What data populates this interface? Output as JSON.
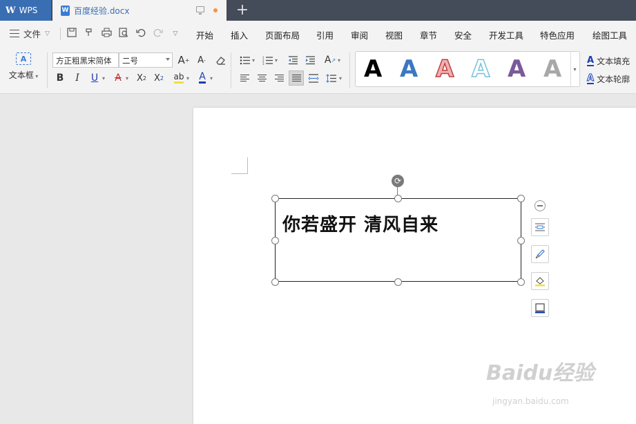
{
  "titlebar": {
    "app_name": "WPS",
    "document_tab": "百度经验.docx",
    "new_tab_symbol": "+",
    "modified_dot_color": "#f49342"
  },
  "menubar": {
    "file_label": "文件",
    "items": [
      {
        "label": "开始"
      },
      {
        "label": "插入"
      },
      {
        "label": "页面布局"
      },
      {
        "label": "引用"
      },
      {
        "label": "审阅"
      },
      {
        "label": "视图"
      },
      {
        "label": "章节"
      },
      {
        "label": "安全"
      },
      {
        "label": "开发工具"
      },
      {
        "label": "特色应用"
      },
      {
        "label": "绘图工具"
      }
    ]
  },
  "ribbon": {
    "textbox_button_label": "文本框",
    "font_name": "方正粗黑宋简体",
    "font_size": "二号",
    "text_fill_label": "文本填充",
    "text_outline_label": "文本轮廓",
    "style_gallery_glyph": "A",
    "style_colors": [
      "#000000",
      "#3b78c2",
      "#e08080",
      "#8fd0e0",
      "#7a5a9a",
      "#888888"
    ]
  },
  "document": {
    "textbox_text": "你若盛开  清风自来"
  },
  "watermark": {
    "brand": "Baidu经验",
    "url": "jingyan.baidu.com"
  }
}
